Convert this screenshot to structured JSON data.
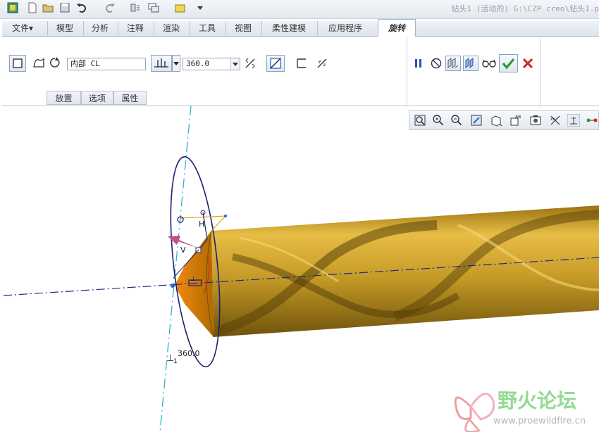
{
  "window": {
    "title": "钻头1 (活动的) G:\\CZP creo\\钻头1.p"
  },
  "ribbon": {
    "tabs": [
      {
        "label": "文件▾"
      },
      {
        "label": "模型"
      },
      {
        "label": "分析"
      },
      {
        "label": "注释"
      },
      {
        "label": "渲染"
      },
      {
        "label": "工具"
      },
      {
        "label": "视图"
      },
      {
        "label": "柔性建模"
      },
      {
        "label": "应用程序"
      },
      {
        "label": "旋转"
      }
    ],
    "active_tab": "旋转"
  },
  "revolve": {
    "axis_value": "内部 CL",
    "angle_value": "360.0",
    "subtabs": [
      {
        "label": "放置"
      },
      {
        "label": "选项"
      },
      {
        "label": "属性"
      }
    ]
  },
  "viewport": {
    "angle_label": "360.0",
    "h_label": "H",
    "v_label": "V",
    "perp_label": "⊥",
    "perp_index": "1"
  },
  "colors": {
    "accent": "#2a66c9",
    "confirm": "#2e9a3a",
    "cancel": "#d22020",
    "model_gold": "#c59a26",
    "axis_cyan": "#2bb7c8",
    "axis_blue": "#1a2c8a",
    "sketch_navy": "#1d1f73",
    "watermark": "#7ad07a"
  },
  "watermark": {
    "text_cn": "野火论坛",
    "text_url": "www.proewildfire.cn"
  }
}
